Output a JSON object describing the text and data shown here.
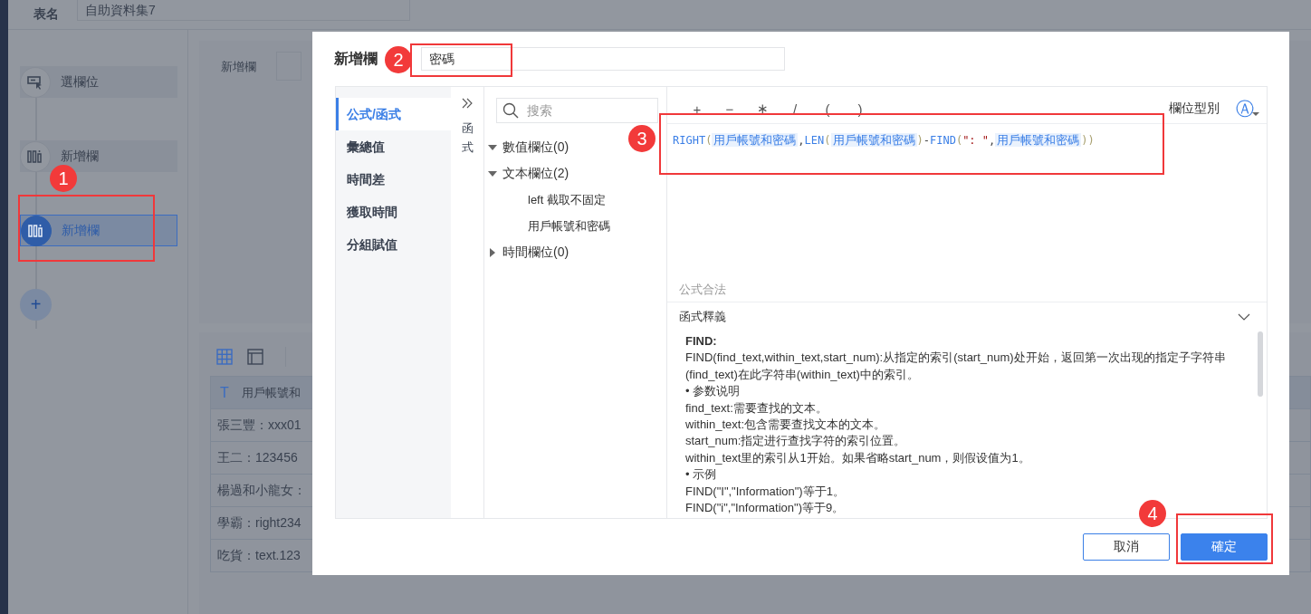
{
  "app": {
    "table_name_label": "表名",
    "table_name_value": "自助資料集7",
    "steps": [
      {
        "label": "選欄位",
        "kind": "select",
        "selected": false
      },
      {
        "label": "新增欄",
        "kind": "column",
        "selected": false
      },
      {
        "label": "新增欄",
        "kind": "column",
        "selected": true
      }
    ],
    "add_step": "+",
    "config_label": "新增欄",
    "view_tabs": [
      {
        "kind": "grid",
        "selected": true
      },
      {
        "kind": "layout",
        "selected": false
      }
    ],
    "preview_table": {
      "columns": [
        {
          "type_icon": "T",
          "label": "用戶帳號和"
        }
      ],
      "rows": [
        "張三豐：xxx01",
        "王二：123456",
        "楊過和小龍女：",
        "學霸：right234",
        "吃貨：text.123"
      ]
    }
  },
  "dialog": {
    "title": "新增欄",
    "name_value": "密碼",
    "tabs": [
      {
        "label": "公式/函式",
        "selected": true
      },
      {
        "label": "彙總值",
        "selected": false
      },
      {
        "label": "時間差",
        "selected": false
      },
      {
        "label": "獲取時間",
        "selected": false
      },
      {
        "label": "分組賦值",
        "selected": false
      }
    ],
    "collapse_label": "函式",
    "search_placeholder": "搜索",
    "tree": [
      {
        "label": "數值欄位(0)",
        "expanded": true
      },
      {
        "label": "文本欄位(2)",
        "expanded": true,
        "children": [
          {
            "label": "left 截取不固定"
          },
          {
            "label": "用戶帳號和密碼"
          }
        ]
      },
      {
        "label": "時間欄位(0)",
        "expanded": false
      }
    ],
    "operators": [
      "+",
      "−",
      "∗",
      "/",
      "(",
      ")"
    ],
    "field_type_label": "欄位型別",
    "field_type_icon": "Ⓐ",
    "formula": [
      {
        "text": "RIGHT",
        "kind": "function"
      },
      {
        "text": "(",
        "kind": "paren"
      },
      {
        "text": "用戶帳號和密碼",
        "kind": "field"
      },
      {
        "text": ",",
        "kind": "punct"
      },
      {
        "text": "LEN",
        "kind": "function"
      },
      {
        "text": "(",
        "kind": "paren"
      },
      {
        "text": "用戶帳號和密碼",
        "kind": "field"
      },
      {
        "text": ")",
        "kind": "paren"
      },
      {
        "text": "-",
        "kind": "punct"
      },
      {
        "text": "FIND",
        "kind": "function"
      },
      {
        "text": "(",
        "kind": "paren"
      },
      {
        "text": "\": \"",
        "kind": "string"
      },
      {
        "text": ",",
        "kind": "punct"
      },
      {
        "text": "用戶帳號和密碼",
        "kind": "field"
      },
      {
        "text": ")",
        "kind": "paren"
      },
      {
        "text": ")",
        "kind": "paren"
      }
    ],
    "status": "公式合法",
    "help_title": "函式釋義",
    "help_expanded": true,
    "help_lines": [
      {
        "kind": "heading",
        "text": "FIND:"
      },
      {
        "kind": "text",
        "text": "FIND(find_text,within_text,start_num):从指定的索引(start_num)处开始，返回第一次出现的指定子字符串(find_text)在此字符串(within_text)中的索引。"
      },
      {
        "kind": "text",
        "text": "• 参数说明"
      },
      {
        "kind": "text",
        "text": "find_text:需要查找的文本。"
      },
      {
        "kind": "text",
        "text": "within_text:包含需要查找文本的文本。"
      },
      {
        "kind": "text",
        "text": "start_num:指定进行查找字符的索引位置。"
      },
      {
        "kind": "text",
        "text": "within_text里的索引从1开始。如果省略start_num，则假设值为1。"
      },
      {
        "kind": "text",
        "text": "• 示例"
      },
      {
        "kind": "text",
        "text": "FIND(\"I\",\"Information\")等于1。"
      },
      {
        "kind": "text",
        "text": "FIND(\"i\",\"Information\")等于9。"
      }
    ],
    "buttons": [
      {
        "label": "取消",
        "kind": "secondary"
      },
      {
        "label": "確定",
        "kind": "primary"
      }
    ]
  },
  "annotations": [
    {
      "number": "1"
    },
    {
      "number": "2"
    },
    {
      "number": "3"
    },
    {
      "number": "4"
    }
  ]
}
